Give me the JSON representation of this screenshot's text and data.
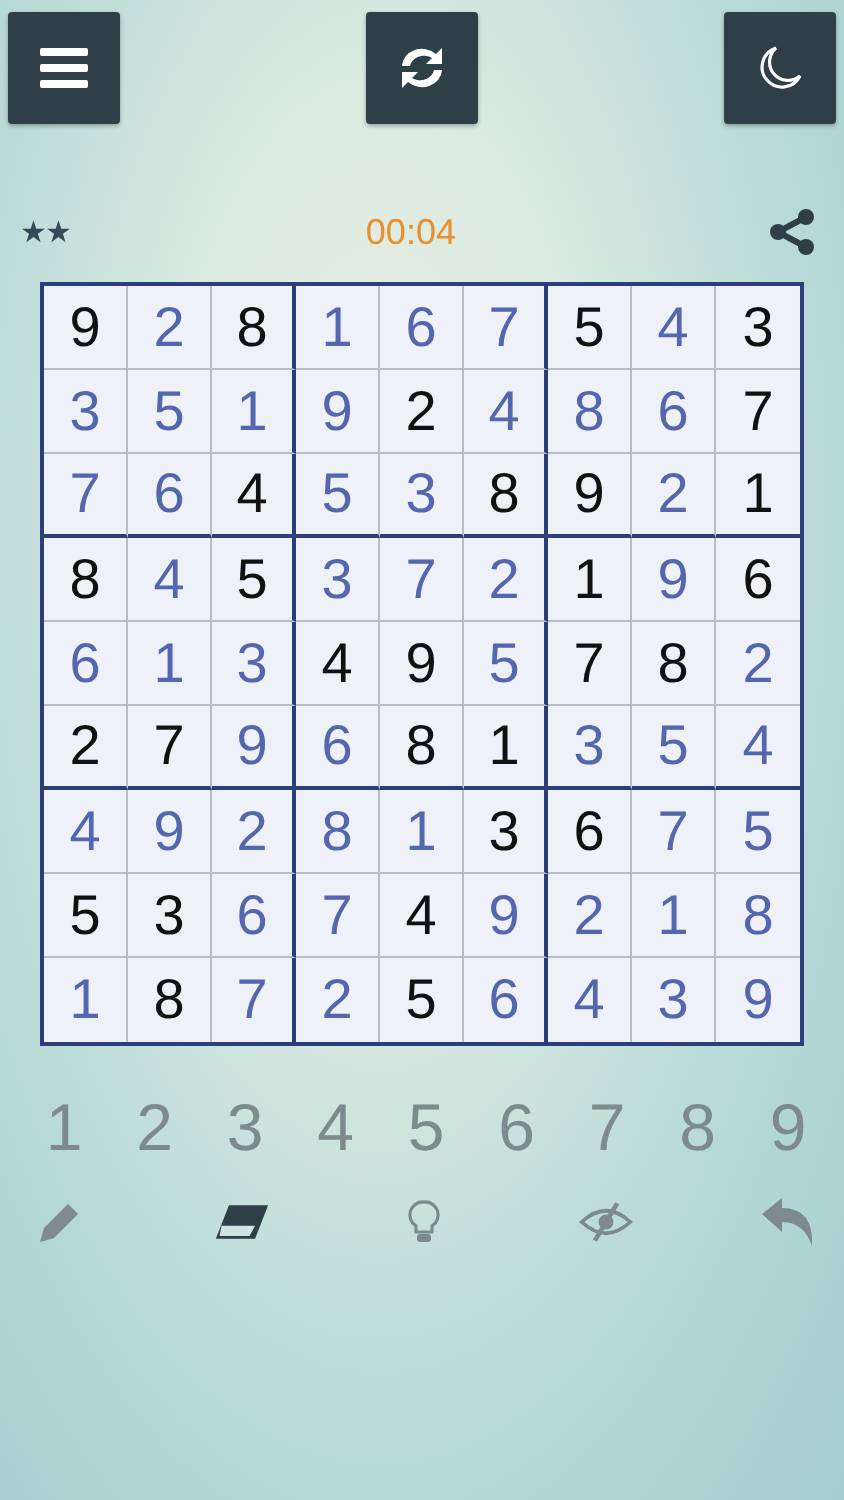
{
  "toolbar": {
    "buttons": [
      {
        "kind": "menu"
      },
      {
        "kind": "refresh"
      },
      {
        "kind": "night"
      }
    ]
  },
  "status": {
    "difficulty": "★★",
    "timer": "00:04"
  },
  "grid": {
    "rows": [
      [
        {
          "v": "9",
          "kind": "given"
        },
        {
          "v": "2",
          "kind": "entered"
        },
        {
          "v": "8",
          "kind": "given"
        },
        {
          "v": "1",
          "kind": "entered"
        },
        {
          "v": "6",
          "kind": "entered"
        },
        {
          "v": "7",
          "kind": "entered"
        },
        {
          "v": "5",
          "kind": "given"
        },
        {
          "v": "4",
          "kind": "entered"
        },
        {
          "v": "3",
          "kind": "given"
        }
      ],
      [
        {
          "v": "3",
          "kind": "entered"
        },
        {
          "v": "5",
          "kind": "entered"
        },
        {
          "v": "1",
          "kind": "entered"
        },
        {
          "v": "9",
          "kind": "entered"
        },
        {
          "v": "2",
          "kind": "given"
        },
        {
          "v": "4",
          "kind": "entered"
        },
        {
          "v": "8",
          "kind": "entered"
        },
        {
          "v": "6",
          "kind": "entered"
        },
        {
          "v": "7",
          "kind": "given"
        }
      ],
      [
        {
          "v": "7",
          "kind": "entered"
        },
        {
          "v": "6",
          "kind": "entered"
        },
        {
          "v": "4",
          "kind": "given"
        },
        {
          "v": "5",
          "kind": "entered"
        },
        {
          "v": "3",
          "kind": "entered"
        },
        {
          "v": "8",
          "kind": "given"
        },
        {
          "v": "9",
          "kind": "given"
        },
        {
          "v": "2",
          "kind": "entered"
        },
        {
          "v": "1",
          "kind": "given"
        }
      ],
      [
        {
          "v": "8",
          "kind": "given"
        },
        {
          "v": "4",
          "kind": "entered"
        },
        {
          "v": "5",
          "kind": "given"
        },
        {
          "v": "3",
          "kind": "entered"
        },
        {
          "v": "7",
          "kind": "entered"
        },
        {
          "v": "2",
          "kind": "entered"
        },
        {
          "v": "1",
          "kind": "given"
        },
        {
          "v": "9",
          "kind": "entered"
        },
        {
          "v": "6",
          "kind": "given"
        }
      ],
      [
        {
          "v": "6",
          "kind": "entered"
        },
        {
          "v": "1",
          "kind": "entered"
        },
        {
          "v": "3",
          "kind": "entered"
        },
        {
          "v": "4",
          "kind": "given"
        },
        {
          "v": "9",
          "kind": "given"
        },
        {
          "v": "5",
          "kind": "entered"
        },
        {
          "v": "7",
          "kind": "given"
        },
        {
          "v": "8",
          "kind": "given"
        },
        {
          "v": "2",
          "kind": "entered"
        }
      ],
      [
        {
          "v": "2",
          "kind": "given"
        },
        {
          "v": "7",
          "kind": "given"
        },
        {
          "v": "9",
          "kind": "entered"
        },
        {
          "v": "6",
          "kind": "entered"
        },
        {
          "v": "8",
          "kind": "given"
        },
        {
          "v": "1",
          "kind": "given"
        },
        {
          "v": "3",
          "kind": "entered"
        },
        {
          "v": "5",
          "kind": "entered"
        },
        {
          "v": "4",
          "kind": "entered"
        }
      ],
      [
        {
          "v": "4",
          "kind": "entered"
        },
        {
          "v": "9",
          "kind": "entered"
        },
        {
          "v": "2",
          "kind": "entered"
        },
        {
          "v": "8",
          "kind": "entered"
        },
        {
          "v": "1",
          "kind": "entered"
        },
        {
          "v": "3",
          "kind": "given"
        },
        {
          "v": "6",
          "kind": "given"
        },
        {
          "v": "7",
          "kind": "entered"
        },
        {
          "v": "5",
          "kind": "entered"
        }
      ],
      [
        {
          "v": "5",
          "kind": "given"
        },
        {
          "v": "3",
          "kind": "given"
        },
        {
          "v": "6",
          "kind": "entered"
        },
        {
          "v": "7",
          "kind": "entered"
        },
        {
          "v": "4",
          "kind": "given"
        },
        {
          "v": "9",
          "kind": "entered"
        },
        {
          "v": "2",
          "kind": "entered"
        },
        {
          "v": "1",
          "kind": "entered"
        },
        {
          "v": "8",
          "kind": "entered"
        }
      ],
      [
        {
          "v": "1",
          "kind": "entered"
        },
        {
          "v": "8",
          "kind": "given"
        },
        {
          "v": "7",
          "kind": "entered"
        },
        {
          "v": "2",
          "kind": "entered"
        },
        {
          "v": "5",
          "kind": "given"
        },
        {
          "v": "6",
          "kind": "entered"
        },
        {
          "v": "4",
          "kind": "entered"
        },
        {
          "v": "3",
          "kind": "entered"
        },
        {
          "v": "9",
          "kind": "entered"
        }
      ]
    ]
  },
  "number_pad": [
    "1",
    "2",
    "3",
    "4",
    "5",
    "6",
    "7",
    "8",
    "9"
  ],
  "tools": [
    {
      "kind": "pencil",
      "selected": false
    },
    {
      "kind": "eraser",
      "selected": true
    },
    {
      "kind": "hint",
      "selected": false
    },
    {
      "kind": "hide",
      "selected": false
    },
    {
      "kind": "undo",
      "selected": false
    }
  ]
}
